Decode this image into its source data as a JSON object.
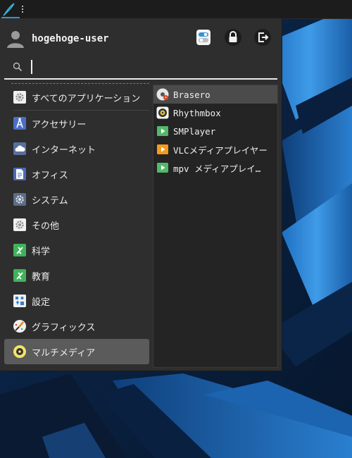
{
  "panel": {
    "menu_icon": "whisker-menu-icon",
    "handle_icon": "panel-handle-icon"
  },
  "user": {
    "name": "hogehoge-user",
    "avatar_icon": "user-avatar-icon"
  },
  "actions": [
    {
      "name": "settings-toggle-button",
      "icon": "settings-toggle-icon"
    },
    {
      "name": "lock-button",
      "icon": "lock-icon"
    },
    {
      "name": "logout-button",
      "icon": "logout-icon"
    }
  ],
  "search": {
    "value": "",
    "placeholder": "",
    "icon": "search-icon"
  },
  "categories": [
    {
      "label": "すべてのアプリケーション",
      "icon": "all-apps-icon"
    },
    {
      "label": "アクセサリー",
      "icon": "accessories-icon"
    },
    {
      "label": "インターネット",
      "icon": "internet-icon"
    },
    {
      "label": "オフィス",
      "icon": "office-icon"
    },
    {
      "label": "システム",
      "icon": "system-icon"
    },
    {
      "label": "その他",
      "icon": "other-icon"
    },
    {
      "label": "科学",
      "icon": "science-icon"
    },
    {
      "label": "教育",
      "icon": "education-icon"
    },
    {
      "label": "設定",
      "icon": "settings-icon"
    },
    {
      "label": "グラフィックス",
      "icon": "graphics-icon"
    },
    {
      "label": "マルチメディア",
      "icon": "multimedia-icon"
    }
  ],
  "selected_category": "マルチメディア",
  "apps": [
    {
      "label": "Brasero",
      "icon": "brasero-icon"
    },
    {
      "label": "Rhythmbox",
      "icon": "rhythmbox-icon"
    },
    {
      "label": "SMPlayer",
      "icon": "smplayer-icon"
    },
    {
      "label": "VLCメディアプレイヤー",
      "icon": "vlc-icon"
    },
    {
      "label": "mpv メディアプレイ…",
      "icon": "mpv-icon"
    }
  ],
  "colors": {
    "accent": "#2f95d8",
    "menu_bg": "#2e2e2e",
    "selected": "#5b5b5b"
  }
}
